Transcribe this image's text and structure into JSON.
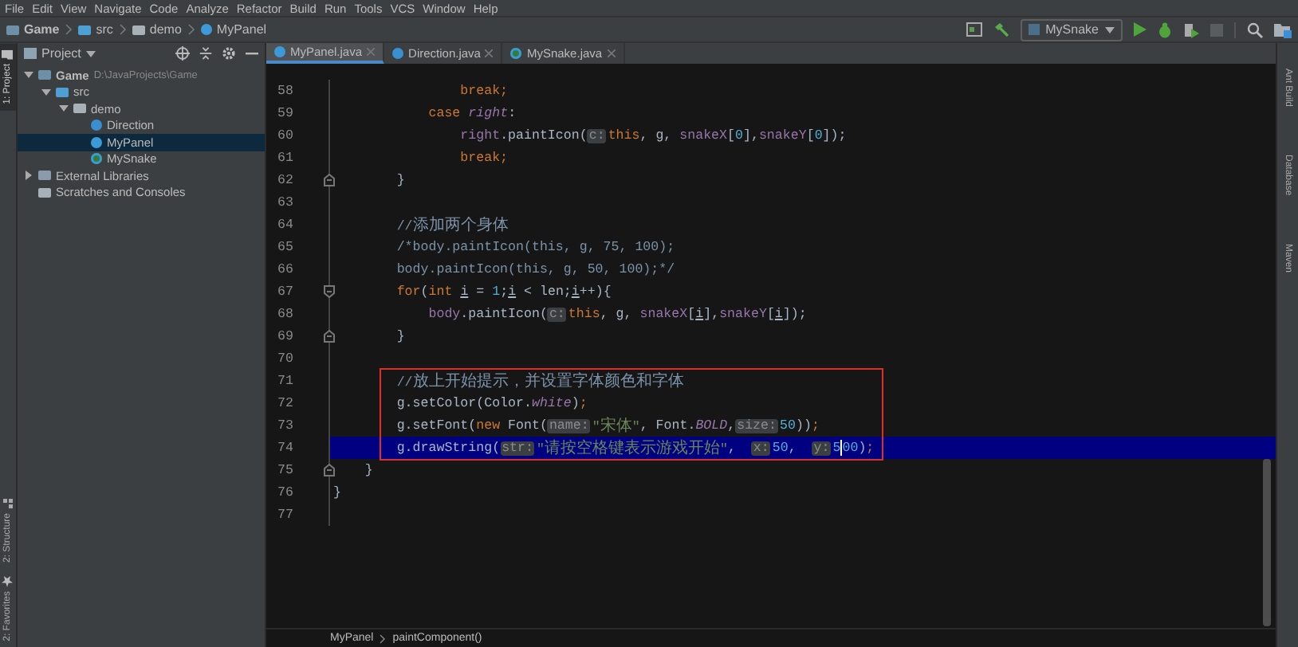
{
  "menu": [
    "File",
    "Edit",
    "View",
    "Navigate",
    "Code",
    "Analyze",
    "Refactor",
    "Build",
    "Run",
    "Tools",
    "VCS",
    "Window",
    "Help"
  ],
  "breadcrumbs": [
    {
      "label": "Game",
      "kind": "module"
    },
    {
      "label": "src",
      "kind": "source-folder"
    },
    {
      "label": "demo",
      "kind": "package"
    },
    {
      "label": "MyPanel",
      "kind": "class"
    }
  ],
  "run_config": "MySnake",
  "left_strip": [
    {
      "label": "1: Project",
      "selected": true,
      "kind": "folder"
    },
    {
      "label": "2: Structure",
      "selected": false,
      "kind": "structure"
    },
    {
      "label": "2: Favorites",
      "selected": false,
      "kind": "star"
    }
  ],
  "right_strip": [
    "Ant Build",
    "Database",
    "Maven"
  ],
  "project": {
    "title": "Project",
    "tree": [
      {
        "label": "Game",
        "path": "D:\\JavaProjects\\Game",
        "kind": "module",
        "expanded": true,
        "selected": false,
        "children": [
          {
            "label": "src",
            "kind": "source-folder",
            "expanded": true,
            "selected": false,
            "children": [
              {
                "label": "demo",
                "kind": "package",
                "expanded": true,
                "selected": false,
                "children": [
                  {
                    "label": "Direction",
                    "kind": "enum",
                    "selected": false
                  },
                  {
                    "label": "MyPanel",
                    "kind": "class",
                    "selected": true
                  },
                  {
                    "label": "MySnake",
                    "kind": "main-class",
                    "selected": false
                  }
                ]
              }
            ]
          }
        ]
      },
      {
        "label": "External Libraries",
        "kind": "libraries",
        "expanded": false,
        "selected": false
      },
      {
        "label": "Scratches and Consoles",
        "kind": "scratches",
        "selected": false
      }
    ]
  },
  "tabs": [
    {
      "label": "MyPanel.java",
      "kind": "class",
      "selected": true
    },
    {
      "label": "Direction.java",
      "kind": "enum",
      "selected": false
    },
    {
      "label": "MySnake.java",
      "kind": "main-class",
      "selected": false
    }
  ],
  "editor": {
    "lines": [
      {
        "number": "58",
        "current": false,
        "boxed": false,
        "tokens": [
          {
            "kind": "kw",
            "text": "                break;"
          }
        ]
      },
      {
        "number": "59",
        "current": false,
        "boxed": false,
        "tokens": [
          {
            "kind": "kw",
            "text": "            case "
          },
          {
            "kind": "static",
            "text": "right"
          },
          {
            "kind": "plain",
            "text": ":"
          }
        ]
      },
      {
        "number": "60",
        "current": false,
        "boxed": false,
        "tokens": [
          {
            "kind": "field",
            "text": "                right"
          },
          {
            "kind": "plain",
            "text": ".paintIcon("
          },
          {
            "kind": "hint",
            "text": "c:"
          },
          {
            "kind": "kw",
            "text": "this"
          },
          {
            "kind": "plain",
            "text": ", g, "
          },
          {
            "kind": "field",
            "text": "snakeX"
          },
          {
            "kind": "plain",
            "text": "["
          },
          {
            "kind": "num",
            "text": "0"
          },
          {
            "kind": "plain",
            "text": "],"
          },
          {
            "kind": "field",
            "text": "snakeY"
          },
          {
            "kind": "plain",
            "text": "["
          },
          {
            "kind": "num",
            "text": "0"
          },
          {
            "kind": "plain",
            "text": "]);"
          }
        ]
      },
      {
        "number": "61",
        "current": false,
        "boxed": false,
        "tokens": [
          {
            "kind": "kw",
            "text": "                break;"
          }
        ]
      },
      {
        "number": "62",
        "current": false,
        "boxed": false,
        "fold_end": true,
        "tokens": [
          {
            "kind": "plain",
            "text": "        }"
          }
        ]
      },
      {
        "number": "63",
        "current": false,
        "boxed": false
      },
      {
        "number": "64",
        "current": false,
        "boxed": false,
        "tokens": [
          {
            "kind": "comment",
            "text": "        //添加两个身体"
          }
        ]
      },
      {
        "number": "65",
        "current": false,
        "boxed": false,
        "tokens": [
          {
            "kind": "comment",
            "text": "        /*body.paintIcon(this, g, 75, 100);"
          }
        ]
      },
      {
        "number": "66",
        "current": false,
        "boxed": false,
        "tokens": [
          {
            "kind": "comment",
            "text": "        body.paintIcon(this, g, 50, 100);*/"
          }
        ]
      },
      {
        "number": "67",
        "current": false,
        "boxed": false,
        "fold_start": true,
        "tokens": [
          {
            "kind": "kw",
            "text": "        for"
          },
          {
            "kind": "plain",
            "text": "("
          },
          {
            "kind": "kw",
            "text": "int "
          },
          {
            "kind": "local",
            "text": "i"
          },
          {
            "kind": "plain",
            "text": " = "
          },
          {
            "kind": "num",
            "text": "1"
          },
          {
            "kind": "plain",
            "text": ";"
          },
          {
            "kind": "local",
            "text": "i"
          },
          {
            "kind": "plain",
            "text": " < len;"
          },
          {
            "kind": "local",
            "text": "i"
          },
          {
            "kind": "plain",
            "text": "++){"
          }
        ]
      },
      {
        "number": "68",
        "current": false,
        "boxed": false,
        "tokens": [
          {
            "kind": "field",
            "text": "            body"
          },
          {
            "kind": "plain",
            "text": ".paintIcon("
          },
          {
            "kind": "hint",
            "text": "c:"
          },
          {
            "kind": "kw",
            "text": "this"
          },
          {
            "kind": "plain",
            "text": ", g, "
          },
          {
            "kind": "field",
            "text": "snakeX"
          },
          {
            "kind": "plain",
            "text": "["
          },
          {
            "kind": "local",
            "text": "i"
          },
          {
            "kind": "plain",
            "text": "],"
          },
          {
            "kind": "field",
            "text": "snakeY"
          },
          {
            "kind": "plain",
            "text": "["
          },
          {
            "kind": "local",
            "text": "i"
          },
          {
            "kind": "plain",
            "text": "]);"
          }
        ]
      },
      {
        "number": "69",
        "current": false,
        "boxed": false,
        "fold_end": true,
        "tokens": [
          {
            "kind": "plain",
            "text": "        }"
          }
        ]
      },
      {
        "number": "70",
        "current": false,
        "boxed": false
      },
      {
        "number": "71",
        "current": false,
        "boxed": true,
        "tokens": [
          {
            "kind": "comment",
            "text": "        //放上开始提示，并设置字体颜色和字体"
          }
        ]
      },
      {
        "number": "72",
        "current": false,
        "boxed": true,
        "tokens": [
          {
            "kind": "plain",
            "text": "        g.setColor(Color."
          },
          {
            "kind": "static",
            "text": "white"
          },
          {
            "kind": "plain",
            "text": ")"
          },
          {
            "kind": "kw",
            "text": ";"
          }
        ]
      },
      {
        "number": "73",
        "current": false,
        "boxed": true,
        "tokens": [
          {
            "kind": "plain",
            "text": "        g.setFont("
          },
          {
            "kind": "kw",
            "text": "new "
          },
          {
            "kind": "plain",
            "text": "Font("
          },
          {
            "kind": "hint",
            "text": "name:"
          },
          {
            "kind": "str",
            "text": "\"宋体\""
          },
          {
            "kind": "plain",
            "text": ", Font."
          },
          {
            "kind": "static",
            "text": "BOLD"
          },
          {
            "kind": "plain",
            "text": ","
          },
          {
            "kind": "hint",
            "text": "size:"
          },
          {
            "kind": "num",
            "text": "50"
          },
          {
            "kind": "plain",
            "text": "))"
          },
          {
            "kind": "kw",
            "text": ";"
          }
        ]
      },
      {
        "number": "74",
        "current": true,
        "boxed": true,
        "tokens": [
          {
            "kind": "plain",
            "text": "        g.drawString("
          },
          {
            "kind": "hint",
            "text": "str:"
          },
          {
            "kind": "str",
            "text": "\"请按空格键表示游戏开始\""
          },
          {
            "kind": "plain",
            "text": ",  "
          },
          {
            "kind": "hint",
            "text": "x:"
          },
          {
            "kind": "num",
            "text": "50"
          },
          {
            "kind": "plain",
            "text": ",  "
          },
          {
            "kind": "hint",
            "text": "y:"
          },
          {
            "kind": "num",
            "text": "5"
          },
          {
            "kind": "caret"
          },
          {
            "kind": "num",
            "text": "00"
          },
          {
            "kind": "plain",
            "text": ")"
          },
          {
            "kind": "kw",
            "text": ";"
          }
        ]
      },
      {
        "number": "75",
        "current": false,
        "boxed": false,
        "fold_end": true,
        "tokens": [
          {
            "kind": "plain",
            "text": "    }"
          }
        ]
      },
      {
        "number": "76",
        "current": false,
        "boxed": false,
        "tokens": [
          {
            "kind": "plain",
            "text": "}"
          }
        ]
      },
      {
        "number": "77",
        "current": false,
        "boxed": false
      }
    ]
  },
  "status_breadcrumbs": [
    "MyPanel",
    "paintComponent()"
  ]
}
